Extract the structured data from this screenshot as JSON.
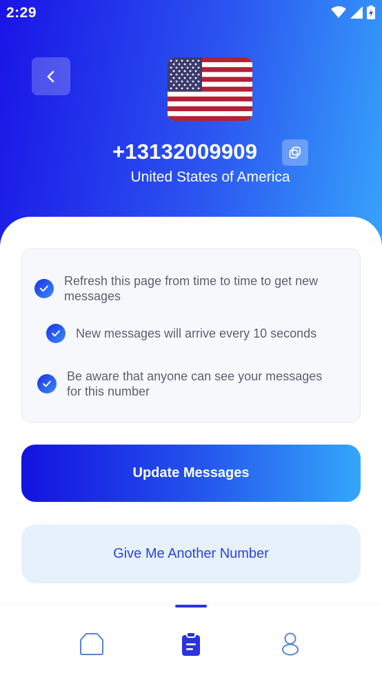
{
  "status_bar": {
    "time": "2:29",
    "icons": [
      "wifi-icon",
      "signal-icon",
      "battery-icon"
    ]
  },
  "header": {
    "back_icon": "chevron-left-icon",
    "flag_icon": "us-flag-icon",
    "phone_number": "+13132009909",
    "copy_icon": "copy-icon",
    "country": "United States of America"
  },
  "info": {
    "items": [
      {
        "text_line1": "Refresh this page from time to time to get new",
        "text_line2": "messages"
      },
      {
        "text_line1": "New messages will arrive every 10 seconds",
        "text_line2": ""
      },
      {
        "text_line1": "Be aware that anyone can see your messages",
        "text_line2": "for this number"
      }
    ]
  },
  "actions": {
    "update_label": "Update Messages",
    "another_label": "Give Me Another Number"
  },
  "bottom_nav": {
    "items": [
      {
        "icon": "home-icon",
        "active": false
      },
      {
        "icon": "clipboard-icon",
        "active": true
      },
      {
        "icon": "profile-icon",
        "active": false
      }
    ]
  },
  "colors": {
    "gradient_start": "#1a14e6",
    "gradient_end": "#37a3fb",
    "accent": "#2b33df",
    "secondary_bg": "#e7f1fb"
  }
}
